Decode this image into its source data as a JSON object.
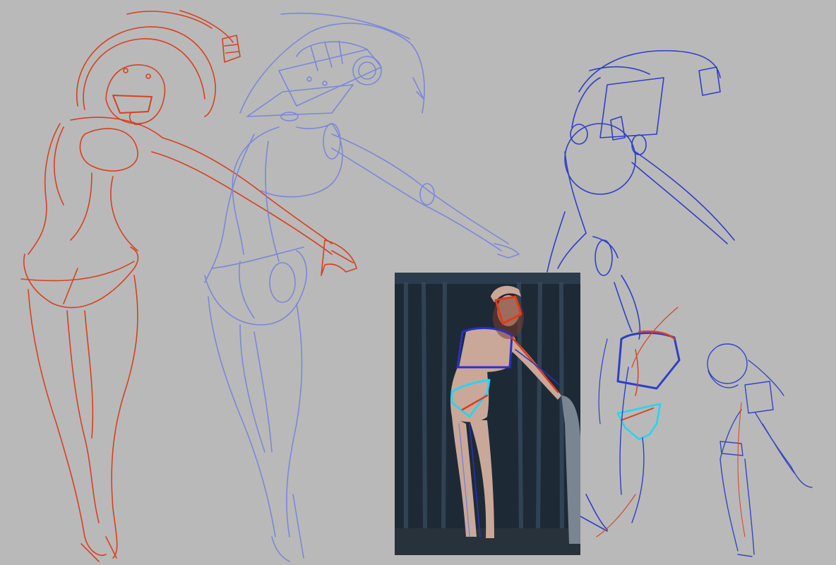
{
  "canvas": {
    "background": "#b9b9b9",
    "description_color_red": "#d9401e",
    "description_color_blue": "#6f7fd8",
    "description_color_darkblue": "#2f3fc8",
    "description_color_cyan": "#22d6f0"
  },
  "sketches": [
    {
      "name": "red-figure-sketch",
      "color": "#d9401e"
    },
    {
      "name": "light-blue-figure-sketch",
      "color": "#7b88d8"
    },
    {
      "name": "dark-blue-figure-sketch",
      "color": "#2f3fc8"
    },
    {
      "name": "torso-study-sketch",
      "color": "#2f3fc8"
    },
    {
      "name": "small-figure-sketch",
      "color": "#3447c4"
    }
  ],
  "reference_photo": {
    "background": "#1d2a36",
    "overlay_colors": [
      "#e23a1a",
      "#2a30c8",
      "#28d4f2"
    ]
  }
}
